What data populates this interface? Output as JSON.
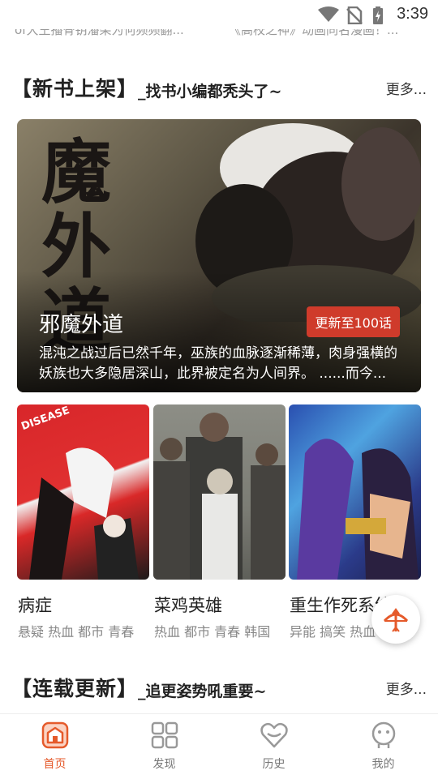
{
  "status_bar": {
    "time": "3:39"
  },
  "prev_row": {
    "left_text": "of大王播骨钥潘柴为何频频翻...",
    "right_text": "《高校之神》动画同名漫画！..."
  },
  "section_new": {
    "title": "【新书上架】",
    "subtitle": "_找书小编都秃头了~",
    "more": "更多..."
  },
  "banner": {
    "calligraphy": "魔外道",
    "title": "邪魔外道",
    "badge": "更新至100话",
    "description": "混沌之战过后已然千年，巫族的血脉逐渐稀薄，肉身强横的妖族也大多隐居深山，此界被定名为人间界。 ......而今..."
  },
  "comics": [
    {
      "name": "病症",
      "tags": "悬疑 热血 都市 青春",
      "cover_text": "DISEASE"
    },
    {
      "name": "菜鸡英雄",
      "tags": "热血 都市 青春 韩国"
    },
    {
      "name": "重生作死系统",
      "tags": "异能 搞笑 热血"
    }
  ],
  "section_serial": {
    "title": "【连载更新】",
    "subtitle": "_追更姿势吼重要~",
    "more": "更多..."
  },
  "nav": [
    {
      "label": "首页",
      "icon": "home-icon",
      "active": true
    },
    {
      "label": "发现",
      "icon": "grid-icon",
      "active": false
    },
    {
      "label": "历史",
      "icon": "heart-icon",
      "active": false
    },
    {
      "label": "我的",
      "icon": "profile-icon",
      "active": false
    }
  ],
  "colors": {
    "accent": "#e55a2b",
    "badge": "#cf3b2b",
    "inactive": "#999999"
  }
}
